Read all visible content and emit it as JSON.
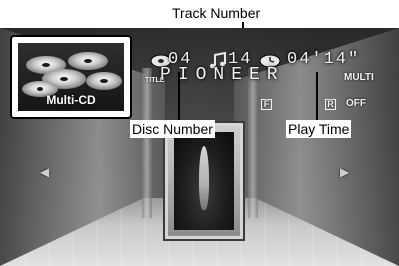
{
  "callouts": {
    "track_number": "Track Number",
    "disc_number": "Disc Number",
    "play_time": "Play Time"
  },
  "source": {
    "label": "Multi-CD"
  },
  "display": {
    "disc": "04",
    "track": "14",
    "time": "04'14\"",
    "title": "PIONEER",
    "title_tag": "TITLE",
    "mode": "MULTI",
    "f_indicator": "F",
    "r_indicator": "R",
    "off_label": "OFF"
  },
  "icons": {
    "disc": "disc-icon",
    "track": "music-note-icon",
    "time": "clock-icon",
    "nav_left": "left-arrow-icon",
    "nav_right": "right-arrow-icon"
  },
  "colors": {
    "display_text": "#f2f2f2",
    "callout_line": "#000000"
  }
}
